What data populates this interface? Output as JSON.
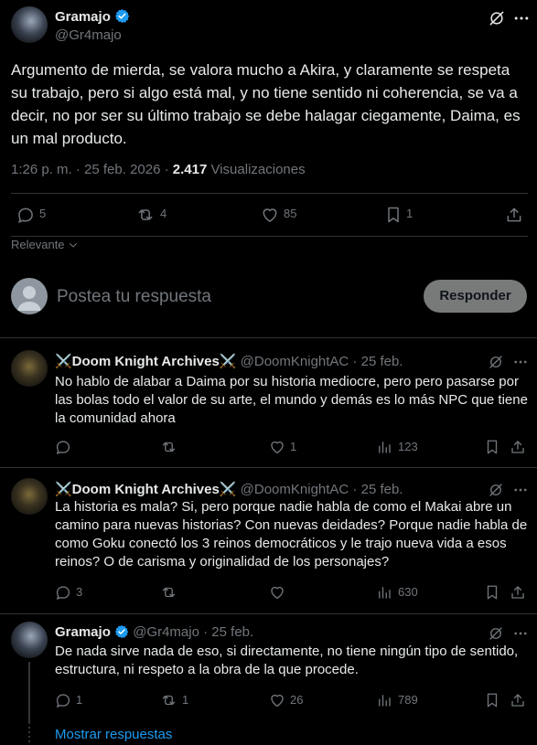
{
  "main_post": {
    "author_name": "Gramajo",
    "author_handle": "@Gr4majo",
    "text": "Argumento de mierda, se valora mucho a Akira, y claramente se respeta su trabajo, pero si algo está mal, y no tiene sentido ni coherencia, se va a decir, no por ser su último trabajo se debe halagar ciegamente, Daima, es un mal producto.",
    "time": "1:26 p. m. · 25 feb. 2026 · ",
    "views_count": "2.417",
    "views_label": " Visualizaciones",
    "replies": "5",
    "reposts": "4",
    "likes": "85",
    "bookmarks": "1"
  },
  "sort": {
    "label": "Relevante"
  },
  "composer": {
    "placeholder": "Postea tu respuesta",
    "button": "Responder"
  },
  "replies": [
    {
      "name": "⚔️Doom Knight Archives⚔️",
      "handle": "@DoomKnightAC",
      "dot": " · ",
      "date": "25 feb.",
      "text": "No hablo de alabar a Daima por su historia mediocre, pero pero pasarse por las bolas todo el valor de su arte, el mundo y demás es lo más NPC que tiene la comunidad ahora",
      "reply_count": "",
      "repost_count": "",
      "like_count": "1",
      "view_count": "123"
    },
    {
      "name": "⚔️Doom Knight Archives⚔️",
      "handle": "@DoomKnightAC",
      "dot": " · ",
      "date": "25 feb.",
      "text": "La historia es mala? Si, pero porque nadie habla de como el Makai abre un camino para nuevas historias? Con nuevas deidades? Porque nadie habla de como Goku conectó los 3 reinos democráticos y le trajo nueva vida a esos reinos? O de carisma y originalidad de los personajes?",
      "reply_count": "3",
      "repost_count": "",
      "like_count": "",
      "view_count": "630"
    },
    {
      "name": "Gramajo",
      "handle": "@Gr4majo",
      "dot": " · ",
      "date": "25 feb.",
      "text": "De nada sirve nada de eso, si directamente, no tiene ningún tipo de sentido, estructura, ni respeto a la obra de la que procede.",
      "reply_count": "1",
      "repost_count": "1",
      "like_count": "26",
      "view_count": "789"
    }
  ],
  "show_replies": "Mostrar respuestas",
  "colors": {
    "background": "#000000",
    "text": "#e7e9ea",
    "muted": "#71767b",
    "link": "#1d9bf0",
    "verified": "#1d9bf0",
    "divider": "#2f3336"
  }
}
